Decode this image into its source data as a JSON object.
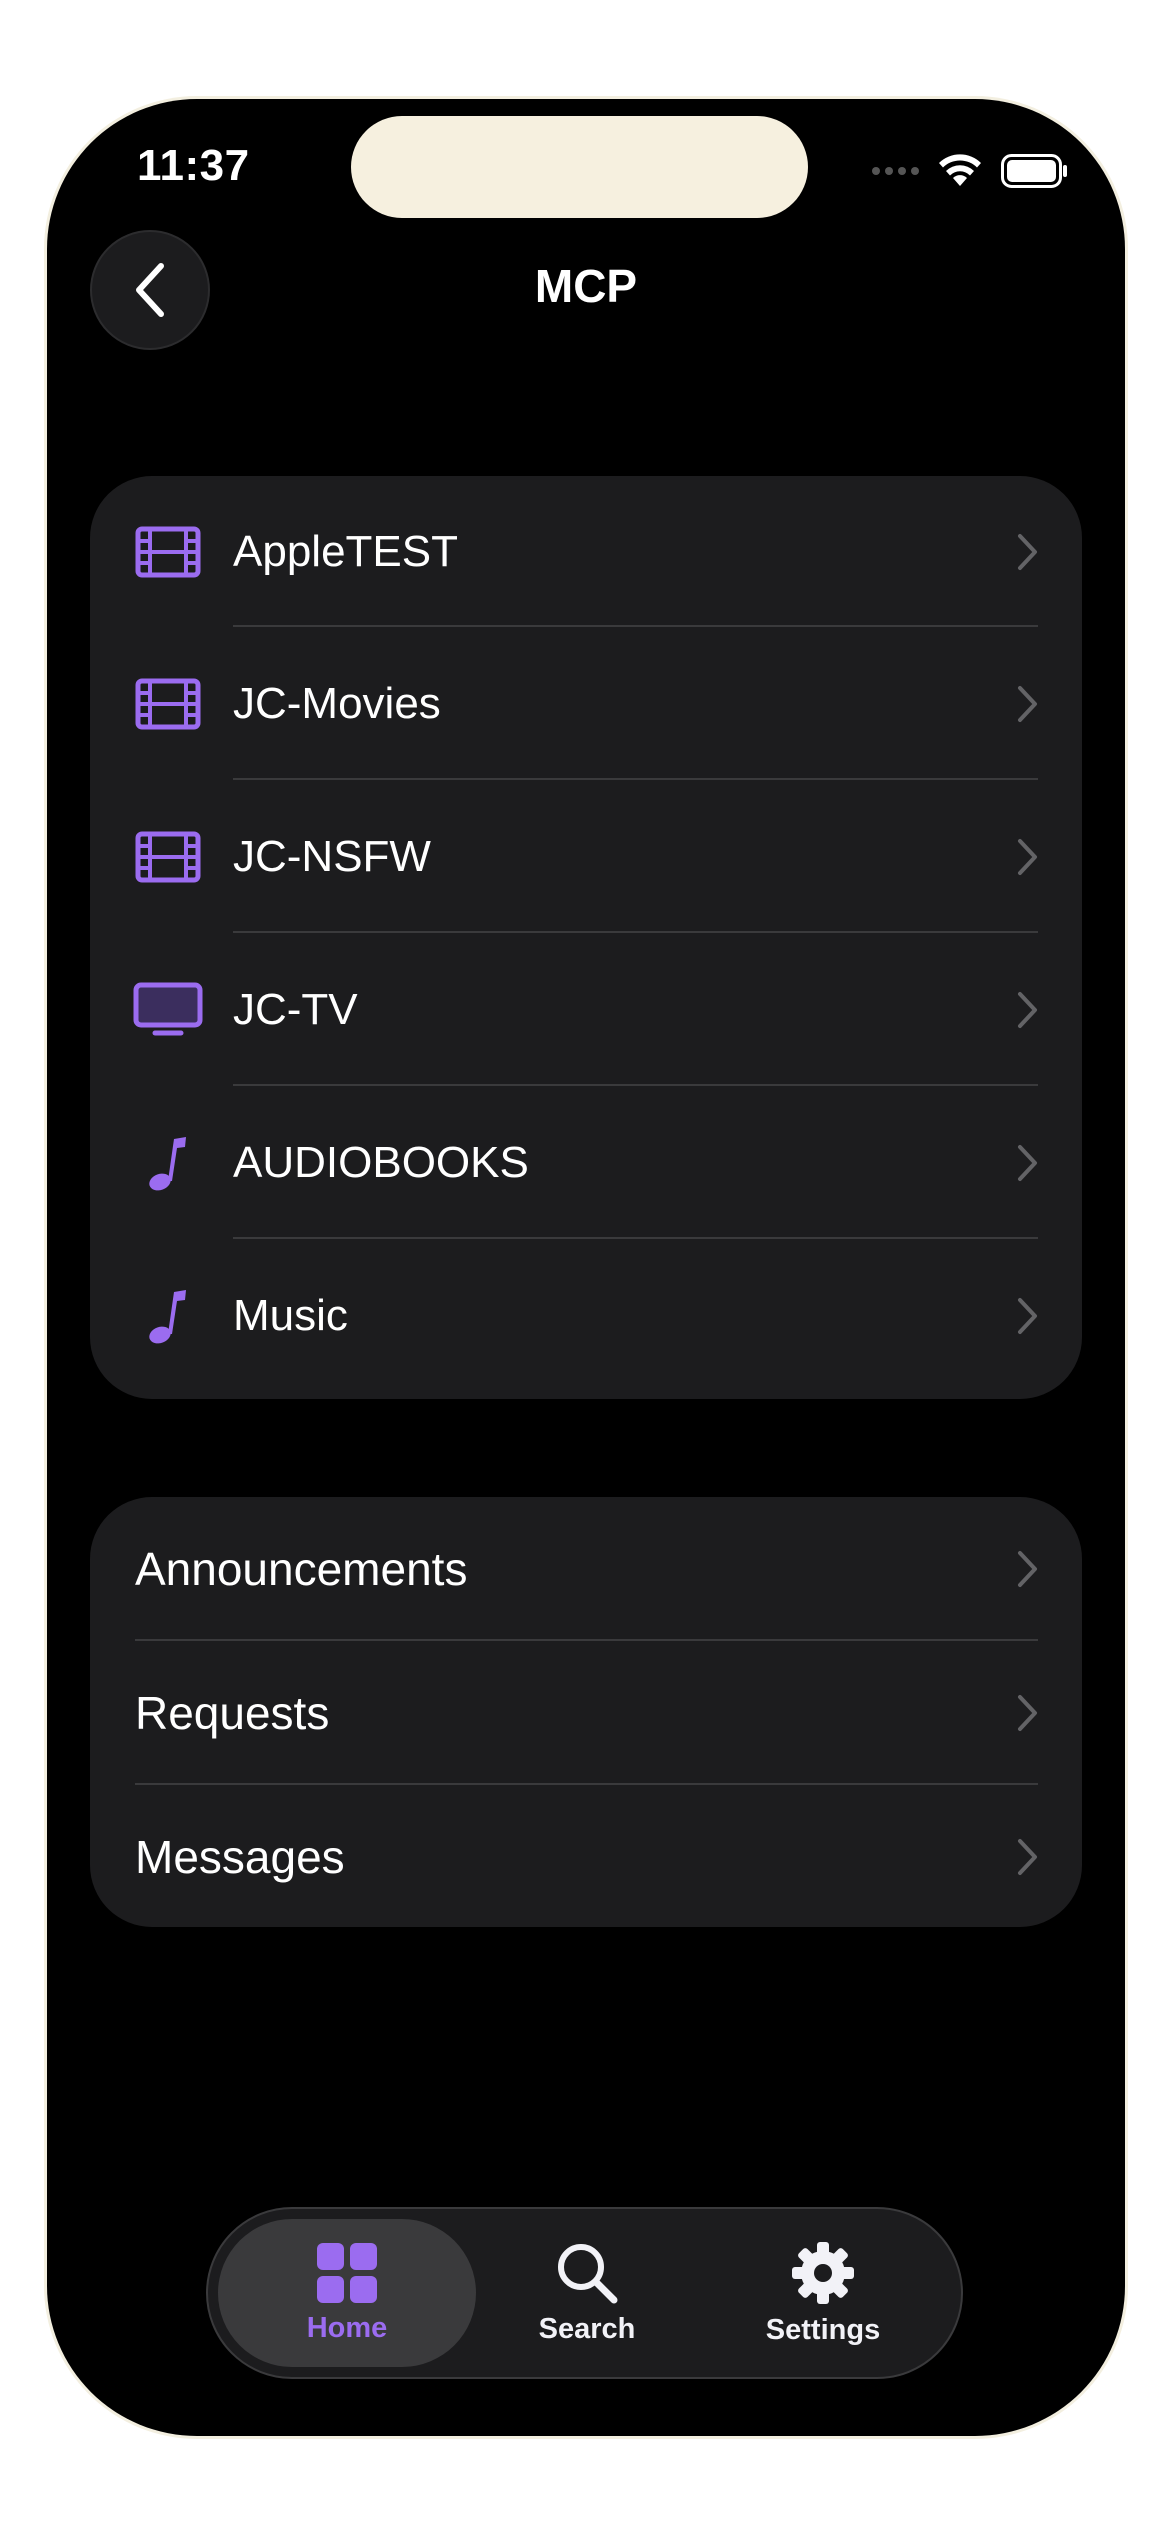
{
  "status_bar": {
    "time": "11:37"
  },
  "nav": {
    "title": "MCP"
  },
  "libraries": [
    {
      "label": "AppleTEST",
      "icon": "film-icon"
    },
    {
      "label": "JC-Movies",
      "icon": "film-icon"
    },
    {
      "label": "JC-NSFW",
      "icon": "film-icon"
    },
    {
      "label": "JC-TV",
      "icon": "tv-icon"
    },
    {
      "label": "AUDIOBOOKS",
      "icon": "music-note-icon"
    },
    {
      "label": "Music",
      "icon": "music-note-icon"
    }
  ],
  "more": [
    {
      "label": "Announcements"
    },
    {
      "label": "Requests"
    },
    {
      "label": "Messages"
    }
  ],
  "tabbar": {
    "home": "Home",
    "search": "Search",
    "settings": "Settings"
  },
  "colors": {
    "accent": "#9b6cf0",
    "background": "#000000",
    "card": "#1c1c1e"
  }
}
